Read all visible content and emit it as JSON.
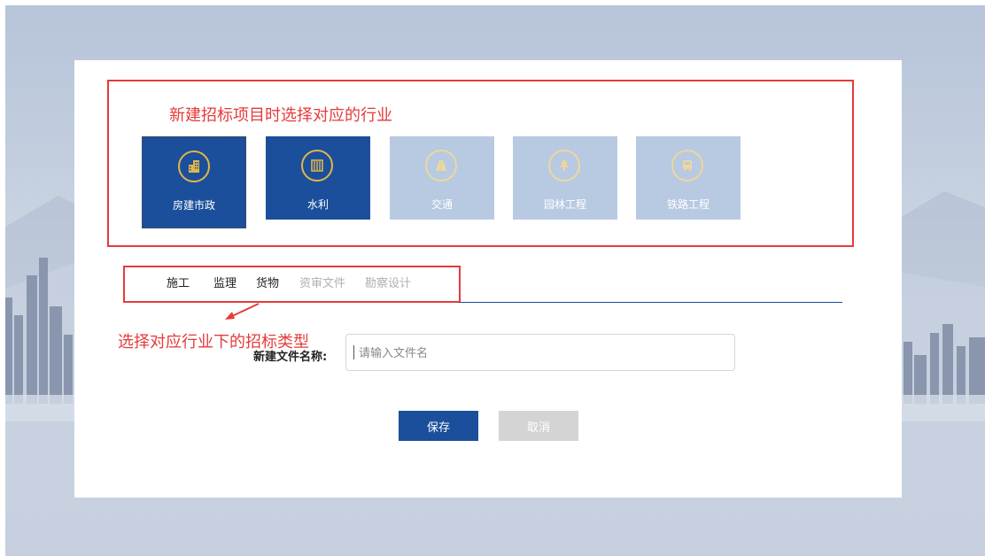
{
  "annotations": {
    "industry_hint": "新建招标项目时选择对应的行业",
    "type_hint": "选择对应行业下的招标类型"
  },
  "industries": [
    {
      "label": "房建市政",
      "icon": "building-icon",
      "state": "active-selected"
    },
    {
      "label": "水利",
      "icon": "water-gate-icon",
      "state": "active"
    },
    {
      "label": "交通",
      "icon": "road-icon",
      "state": "inactive"
    },
    {
      "label": "园林工程",
      "icon": "tree-icon",
      "state": "inactive"
    },
    {
      "label": "铁路工程",
      "icon": "train-icon",
      "state": "inactive"
    }
  ],
  "tabs": [
    {
      "label": "施工",
      "enabled": true
    },
    {
      "label": "监理",
      "enabled": true
    },
    {
      "label": "货物",
      "enabled": true
    },
    {
      "label": "资审文件",
      "enabled": false
    },
    {
      "label": "勘察设计",
      "enabled": false
    }
  ],
  "form": {
    "filename_label": "新建文件名称:",
    "filename_placeholder": "请输入文件名",
    "filename_value": ""
  },
  "buttons": {
    "save": "保存",
    "cancel": "取消"
  },
  "colors": {
    "primary": "#1b4f9b",
    "tile_inactive": "#b8c9e2",
    "icon_ring": "#e2b54a",
    "annotation": "#e53b3b",
    "button_disabled": "#d4d4d4"
  }
}
